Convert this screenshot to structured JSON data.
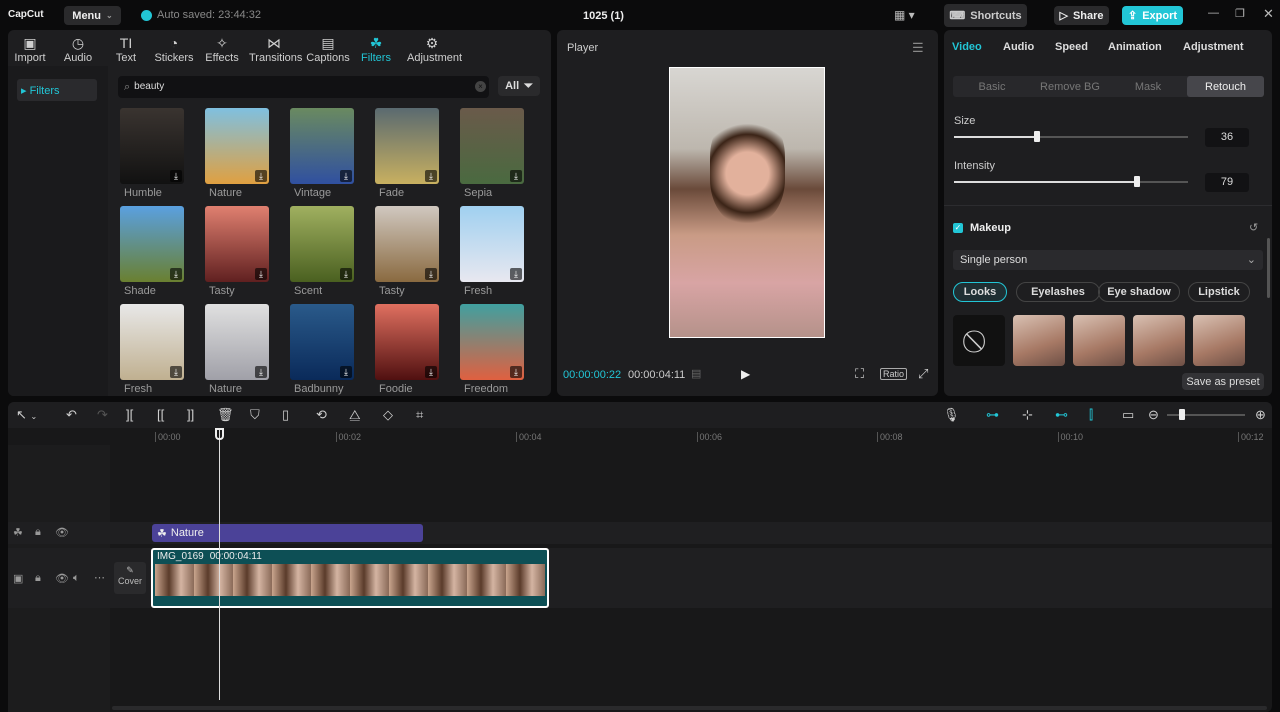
{
  "app": {
    "logo": "CapCut",
    "menu": "Menu",
    "autosave": "Auto saved: 23:44:32",
    "project_title": "1025 (1)",
    "shortcuts": "Shortcuts",
    "share": "Share",
    "export": "Export",
    "accent": "#22c6d6"
  },
  "media_tabs": [
    {
      "label": "Import",
      "icon": "import-icon"
    },
    {
      "label": "Audio",
      "icon": "audio-icon"
    },
    {
      "label": "Text",
      "icon": "text-icon"
    },
    {
      "label": "Stickers",
      "icon": "sticker-icon"
    },
    {
      "label": "Effects",
      "icon": "effects-icon"
    },
    {
      "label": "Transitions",
      "icon": "transitions-icon"
    },
    {
      "label": "Captions",
      "icon": "captions-icon"
    },
    {
      "label": "Filters",
      "icon": "filters-icon",
      "active": true
    },
    {
      "label": "Adjustment",
      "icon": "adjustment-icon"
    }
  ],
  "filters": {
    "sidebar_item": "Filters",
    "search_value": "beauty",
    "all_label": "All",
    "items": [
      {
        "name": "Humble",
        "c1": "#3a3430",
        "c2": "#111"
      },
      {
        "name": "Nature",
        "c1": "#7fc0e0",
        "c2": "#e0a040"
      },
      {
        "name": "Vintage",
        "c1": "#6a8a60",
        "c2": "#3050a0"
      },
      {
        "name": "Fade",
        "c1": "#5a6a70",
        "c2": "#c8b060"
      },
      {
        "name": "Sepia",
        "c1": "#6a5a4a",
        "c2": "#4a6a40"
      },
      {
        "name": "Shade",
        "c1": "#5aa0e0",
        "c2": "#6a8030"
      },
      {
        "name": "Tasty",
        "c1": "#e08070",
        "c2": "#602020"
      },
      {
        "name": "Scent",
        "c1": "#a0b060",
        "c2": "#4a6020"
      },
      {
        "name": "Tasty",
        "c1": "#d0c8c0",
        "c2": "#8a6a40"
      },
      {
        "name": "Fresh",
        "c1": "#a0d0f0",
        "c2": "#e8e8f0"
      },
      {
        "name": "Fresh",
        "c1": "#e8e8e8",
        "c2": "#c0b090"
      },
      {
        "name": "Nature",
        "c1": "#e0e0e0",
        "c2": "#a0a0a8"
      },
      {
        "name": "Badbunny",
        "c1": "#2a5a8a",
        "c2": "#0a2a5a"
      },
      {
        "name": "Foodie",
        "c1": "#e07060",
        "c2": "#501010"
      },
      {
        "name": "Freedom",
        "c1": "#40a0a0",
        "c2": "#e06040"
      }
    ]
  },
  "player": {
    "title": "Player",
    "current_time": "00:00:00:22",
    "total_time": "00:00:04:11",
    "ratio": "Ratio"
  },
  "inspector": {
    "tabs": [
      "Video",
      "Audio",
      "Speed",
      "Animation",
      "Adjustment"
    ],
    "subtabs": [
      "Basic",
      "Remove BG",
      "Mask",
      "Retouch"
    ],
    "size_label": "Size",
    "size_value": "36",
    "intensity_label": "Intensity",
    "intensity_value": "79",
    "makeup_label": "Makeup",
    "makeup_checked": true,
    "person_select": "Single person",
    "makeup_tabs": [
      "Looks",
      "Eyelashes",
      "Eye shadow",
      "Lipstick"
    ],
    "save_preset": "Save as preset"
  },
  "timeline": {
    "ticks": [
      "00:00",
      "00:02",
      "00:04",
      "00:06",
      "00:08",
      "00:10",
      "00:12"
    ],
    "filter_clip": "Nature",
    "video_clip_name": "IMG_0169",
    "video_clip_duration": "00:00:04:11",
    "cover": "Cover"
  }
}
